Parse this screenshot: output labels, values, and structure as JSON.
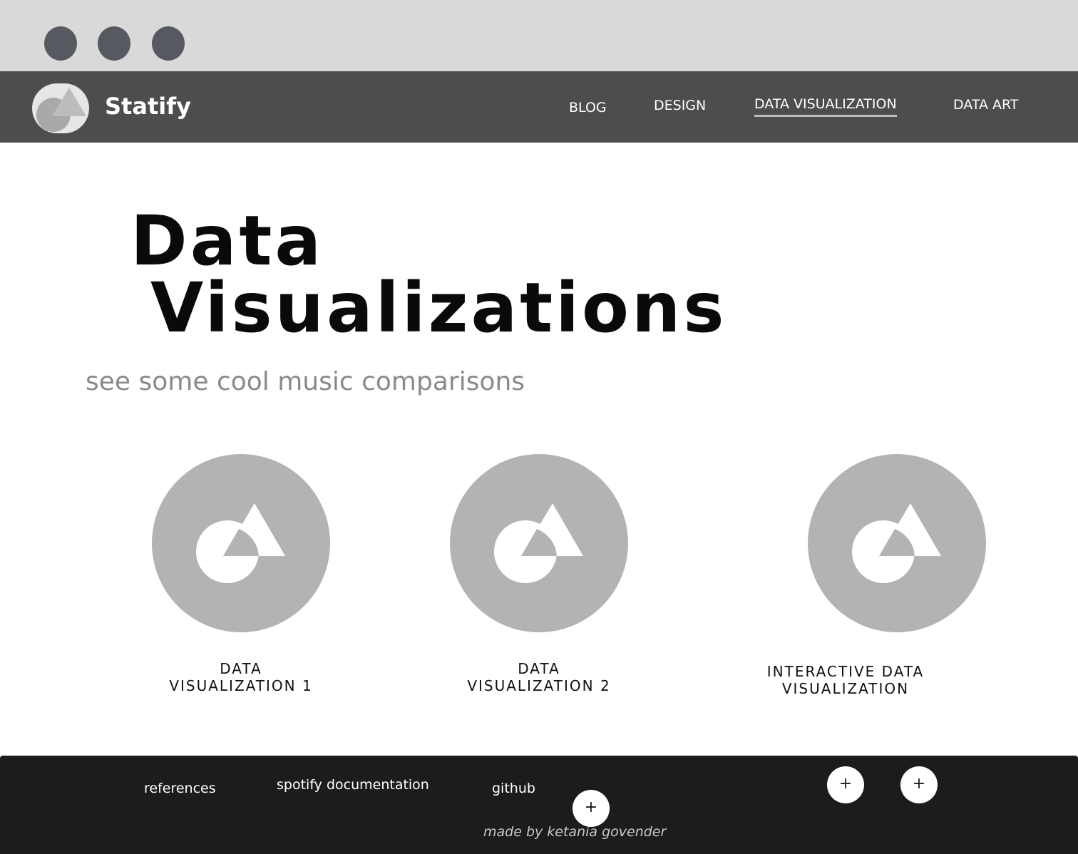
{
  "browser": {
    "window_controls": [
      "close",
      "minimize",
      "maximize"
    ]
  },
  "nav": {
    "brand": "Statify",
    "links": [
      {
        "label": "BLOG",
        "active": false
      },
      {
        "label": "DESIGN",
        "active": false
      },
      {
        "label": "DATA VISUALIZATION",
        "active": true
      },
      {
        "label": "DATA ART",
        "active": false
      }
    ]
  },
  "hero": {
    "title_line1": "Data",
    "title_line2": "Visualizations",
    "subtitle": "see some cool music comparisons"
  },
  "cards": [
    {
      "label_line1": "DATA",
      "label_line2": "VISUALIZATION 1",
      "icon": "image-placeholder-icon"
    },
    {
      "label_line1": "DATA",
      "label_line2": "VISUALIZATION 2",
      "icon": "image-placeholder-icon"
    },
    {
      "label_line1": "INTERACTIVE DATA",
      "label_line2": "VISUALIZATION",
      "icon": "image-placeholder-icon"
    }
  ],
  "footer": {
    "links": [
      "references",
      "spotify documentation",
      "github"
    ],
    "plus_symbol": "+",
    "credit": "made by ketania govender"
  },
  "colors": {
    "chrome": "#d9d9d9",
    "nav": "#4d4d4d",
    "footer": "#1c1c1c",
    "placeholder": "#b3b3b3",
    "subtitle": "#8a8a8a"
  }
}
